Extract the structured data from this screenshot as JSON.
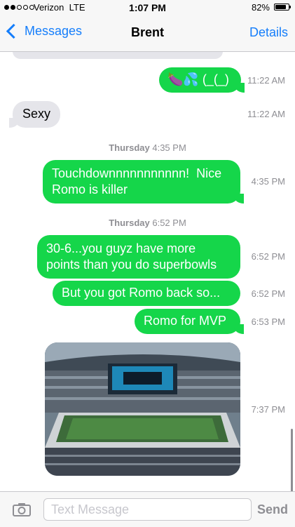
{
  "status_bar": {
    "carrier": "Verizon",
    "network": "LTE",
    "time": "1:07 PM",
    "battery_percent": "82%",
    "battery_level": 0.82,
    "signal_bars_filled": 2,
    "signal_bars_total": 5
  },
  "nav": {
    "back_label": "Messages",
    "title": "Brent",
    "details_label": "Details"
  },
  "messages": [
    {
      "direction": "outgoing",
      "text": "🍆💦 (_(_)",
      "time": "11:22 AM"
    },
    {
      "direction": "incoming",
      "text": "Sexy",
      "time": "11:22 AM"
    },
    {
      "day_header": "Thursday",
      "day_time": "4:35 PM"
    },
    {
      "direction": "outgoing",
      "text_lines": [
        "Touchdownnnnnnnnnnn!  Nice",
        "Romo is killer"
      ],
      "time": "4:35 PM"
    },
    {
      "day_header": "Thursday",
      "day_time": "6:52 PM"
    },
    {
      "direction": "outgoing",
      "text_lines": [
        "30-6...you guyz have more",
        "points than you do superbowls"
      ],
      "time": "6:52 PM"
    },
    {
      "direction": "outgoing",
      "text": "But you got Romo back so...",
      "time": "6:52 PM"
    },
    {
      "direction": "outgoing",
      "text": "Romo for MVP",
      "time": "6:53 PM"
    },
    {
      "direction": "outgoing",
      "type": "photo",
      "time": "7:37 PM"
    }
  ],
  "input": {
    "placeholder": "Text Message",
    "value": "",
    "send_label": "Send"
  },
  "colors": {
    "accent": "#157efb",
    "outgoing_bubble": "#15d64a",
    "incoming_bubble": "#e5e5ea"
  }
}
